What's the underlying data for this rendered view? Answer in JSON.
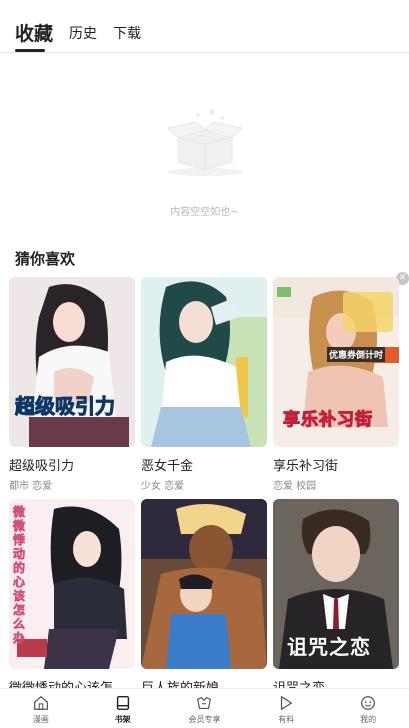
{
  "tabs": [
    {
      "label": "收藏",
      "active": true
    },
    {
      "label": "历史",
      "active": false
    },
    {
      "label": "下载",
      "active": false
    }
  ],
  "empty_state": {
    "text": "内容空空如也~"
  },
  "recommend": {
    "title": "猜你喜欢",
    "items": [
      {
        "title": "超级吸引力",
        "tags": "都市 恋爱",
        "cover_text": "超级吸引力"
      },
      {
        "title": "恶女千金",
        "tags": "少女 恋爱",
        "cover_text": ""
      },
      {
        "title": "享乐补习街",
        "tags": "恋爱 校园",
        "cover_text": "享乐补习街",
        "cover_sub": "优惠券倒计时"
      },
      {
        "title": "微微悸动的心该怎...",
        "tags": "",
        "cover_text": "微微悸动的心该怎么办"
      },
      {
        "title": "巨人族的新娘",
        "tags": "",
        "cover_text": ""
      },
      {
        "title": "诅咒之恋",
        "tags": "",
        "cover_text": "诅咒之恋"
      }
    ]
  },
  "bottom_nav": [
    {
      "label": "漫画",
      "icon": "home-icon",
      "active": false
    },
    {
      "label": "书架",
      "icon": "bookshelf-icon",
      "active": true
    },
    {
      "label": "会员专享",
      "icon": "vip-icon",
      "active": false
    },
    {
      "label": "有料",
      "icon": "play-icon",
      "active": false
    },
    {
      "label": "我的",
      "icon": "profile-icon",
      "active": false
    }
  ]
}
